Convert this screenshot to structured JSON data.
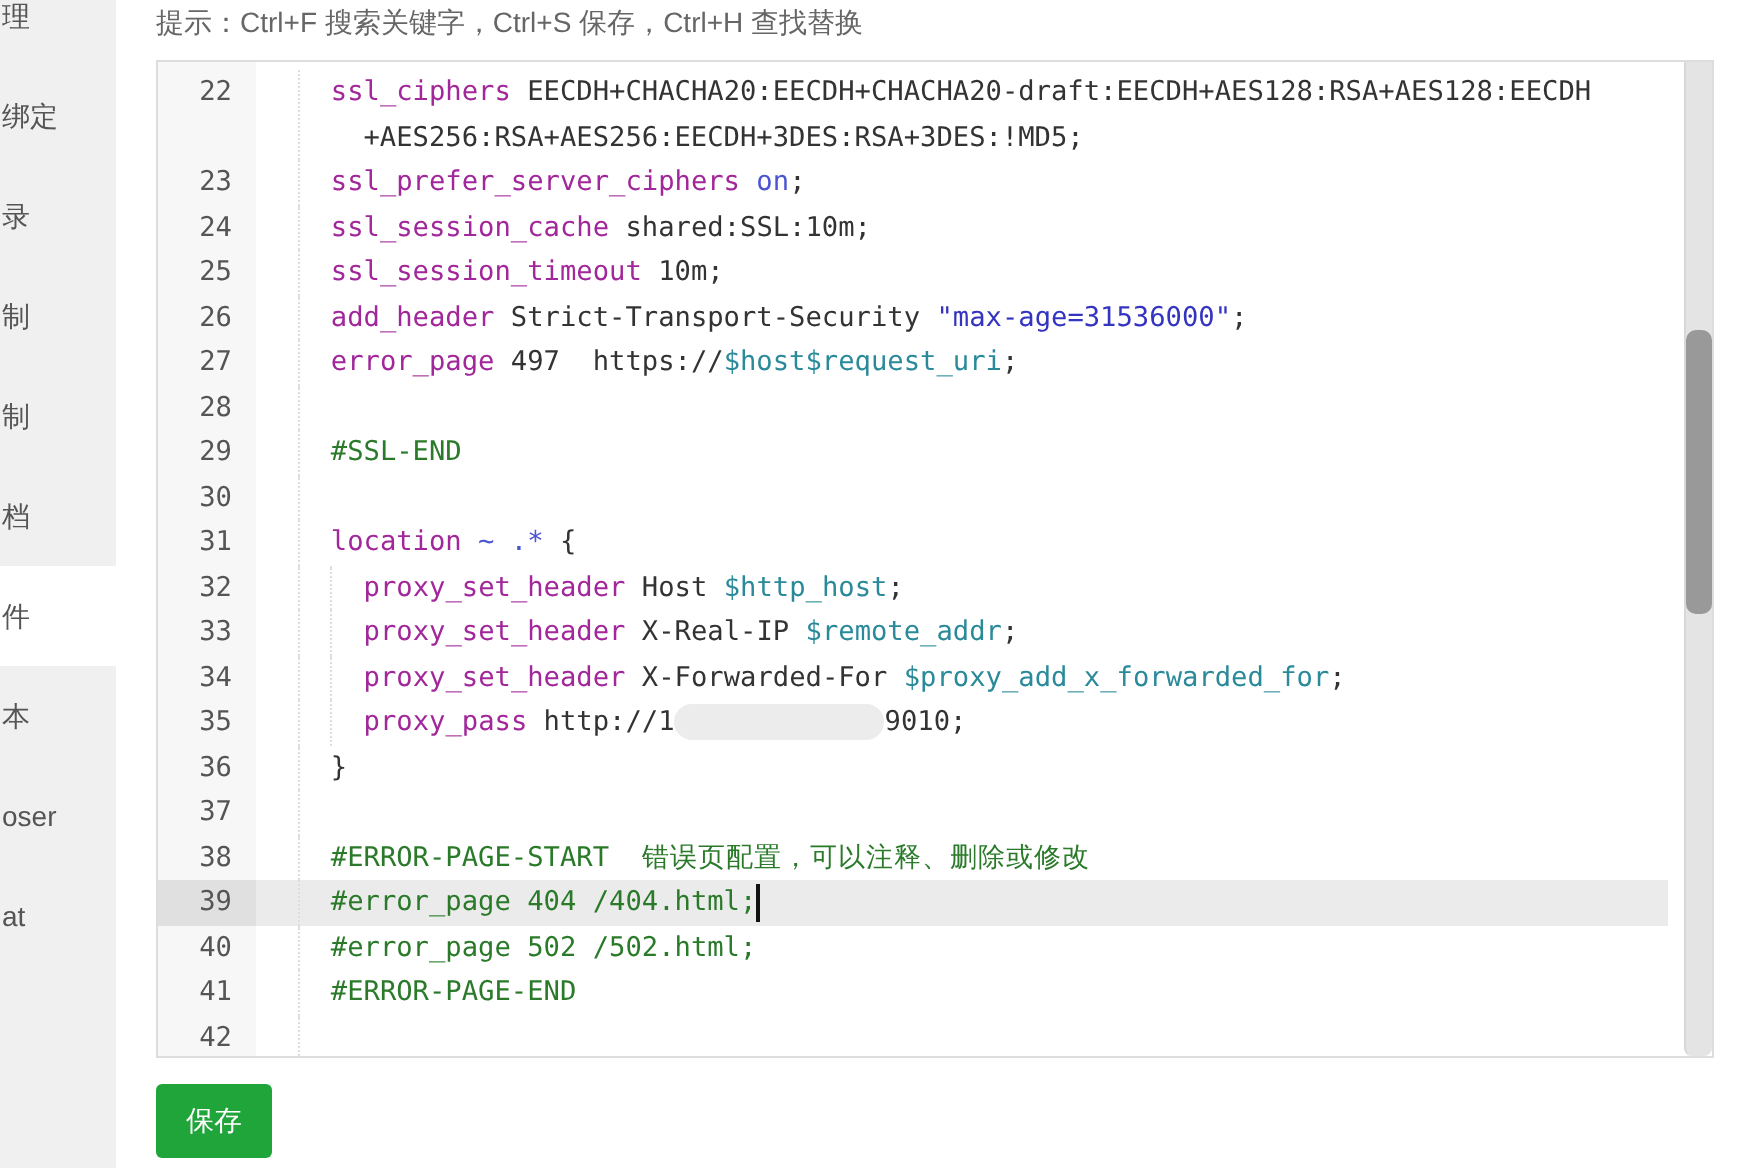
{
  "sidebar": {
    "items": [
      {
        "label": "理",
        "selected": false
      },
      {
        "label": "绑定",
        "selected": false
      },
      {
        "label": "录",
        "selected": false
      },
      {
        "label": "制",
        "selected": false
      },
      {
        "label": "制",
        "selected": false
      },
      {
        "label": "档",
        "selected": false
      },
      {
        "label": "件",
        "selected": true
      },
      {
        "label": "本",
        "selected": false
      },
      {
        "label": "oser",
        "selected": false
      },
      {
        "label": "at",
        "selected": false
      }
    ]
  },
  "hint": "提示：Ctrl+F 搜索关键字，Ctrl+S 保存，Ctrl+H 查找替换",
  "editor": {
    "lines": [
      {
        "number": "22",
        "active": false,
        "tokens": [
          {
            "kind": "keyword",
            "text": "ssl_ciphers"
          },
          {
            "kind": "plain",
            "text": " EECDH+CHACHA20:EECDH+CHACHA20-draft:EECDH+AES128:RSA+AES128:EECDH+AES256:RSA+AES256:EECDH+3DES:RSA+3DES:!MD5;"
          }
        ]
      },
      {
        "number": "23",
        "active": false,
        "tokens": [
          {
            "kind": "keyword",
            "text": "ssl_prefer_server_ciphers"
          },
          {
            "kind": "atom",
            "text": " on"
          },
          {
            "kind": "plain",
            "text": ";"
          }
        ]
      },
      {
        "number": "24",
        "active": false,
        "tokens": [
          {
            "kind": "keyword",
            "text": "ssl_session_cache"
          },
          {
            "kind": "plain",
            "text": " shared:SSL:10m;"
          }
        ]
      },
      {
        "number": "25",
        "active": false,
        "tokens": [
          {
            "kind": "keyword",
            "text": "ssl_session_timeout"
          },
          {
            "kind": "plain",
            "text": " 10m;"
          }
        ]
      },
      {
        "number": "26",
        "active": false,
        "tokens": [
          {
            "kind": "keyword",
            "text": "add_header"
          },
          {
            "kind": "plain",
            "text": " Strict-Transport-Security "
          },
          {
            "kind": "string",
            "text": "\"max-age=31536000\""
          },
          {
            "kind": "plain",
            "text": ";"
          }
        ]
      },
      {
        "number": "27",
        "active": false,
        "tokens": [
          {
            "kind": "keyword",
            "text": "error_page"
          },
          {
            "kind": "plain",
            "text": " 497  https://"
          },
          {
            "kind": "variable",
            "text": "$host$request_uri"
          },
          {
            "kind": "plain",
            "text": ";"
          }
        ]
      },
      {
        "number": "28",
        "active": false
      },
      {
        "number": "29",
        "active": false,
        "tokens": [
          {
            "kind": "comment",
            "text": "#SSL-END"
          }
        ]
      },
      {
        "number": "30",
        "active": false
      },
      {
        "number": "31",
        "active": false,
        "tokens": [
          {
            "kind": "keyword",
            "text": "location"
          },
          {
            "kind": "atom",
            "text": " ~ .*"
          },
          {
            "kind": "plain",
            "text": " {"
          }
        ],
        "children": [
          {
            "number": "32",
            "active": false,
            "tokens": [
              {
                "kind": "keyword",
                "text": "proxy_set_header"
              },
              {
                "kind": "plain",
                "text": " Host "
              },
              {
                "kind": "variable",
                "text": "$http_host"
              },
              {
                "kind": "plain",
                "text": ";"
              }
            ]
          },
          {
            "number": "33",
            "active": false,
            "tokens": [
              {
                "kind": "keyword",
                "text": "proxy_set_header"
              },
              {
                "kind": "plain",
                "text": " X-Real-IP "
              },
              {
                "kind": "variable",
                "text": "$remote_addr"
              },
              {
                "kind": "plain",
                "text": ";"
              }
            ]
          },
          {
            "number": "34",
            "active": false,
            "tokens": [
              {
                "kind": "keyword",
                "text": "proxy_set_header"
              },
              {
                "kind": "plain",
                "text": " X-Forwarded-For "
              },
              {
                "kind": "variable",
                "text": "$proxy_add_x_forwarded_for"
              },
              {
                "kind": "plain",
                "text": ";"
              }
            ]
          },
          {
            "number": "35",
            "active": false,
            "tokens": [
              {
                "kind": "keyword",
                "text": "proxy_pass"
              },
              {
                "kind": "plain",
                "text": " http://1"
              },
              {
                "kind": "redacted"
              },
              {
                "kind": "plain",
                "text": "9010;"
              }
            ]
          }
        ]
      },
      {
        "number": "36",
        "active": false,
        "tokens": [
          {
            "kind": "plain",
            "text": "}"
          }
        ]
      },
      {
        "number": "37",
        "active": false
      },
      {
        "number": "38",
        "active": false,
        "tokens": [
          {
            "kind": "comment",
            "text": "#ERROR-PAGE-START  错误页配置，可以注释、删除或修改"
          }
        ]
      },
      {
        "number": "39",
        "active": true,
        "tokens": [
          {
            "kind": "comment",
            "text": "#error_page 404 /404.html;"
          }
        ]
      },
      {
        "number": "40",
        "active": false,
        "tokens": [
          {
            "kind": "comment",
            "text": "#error_page 502 /502.html;"
          }
        ]
      },
      {
        "number": "41",
        "active": false,
        "tokens": [
          {
            "kind": "comment",
            "text": "#ERROR-PAGE-END"
          }
        ]
      },
      {
        "number": "42",
        "active": false
      }
    ]
  },
  "save_button": "保存"
}
